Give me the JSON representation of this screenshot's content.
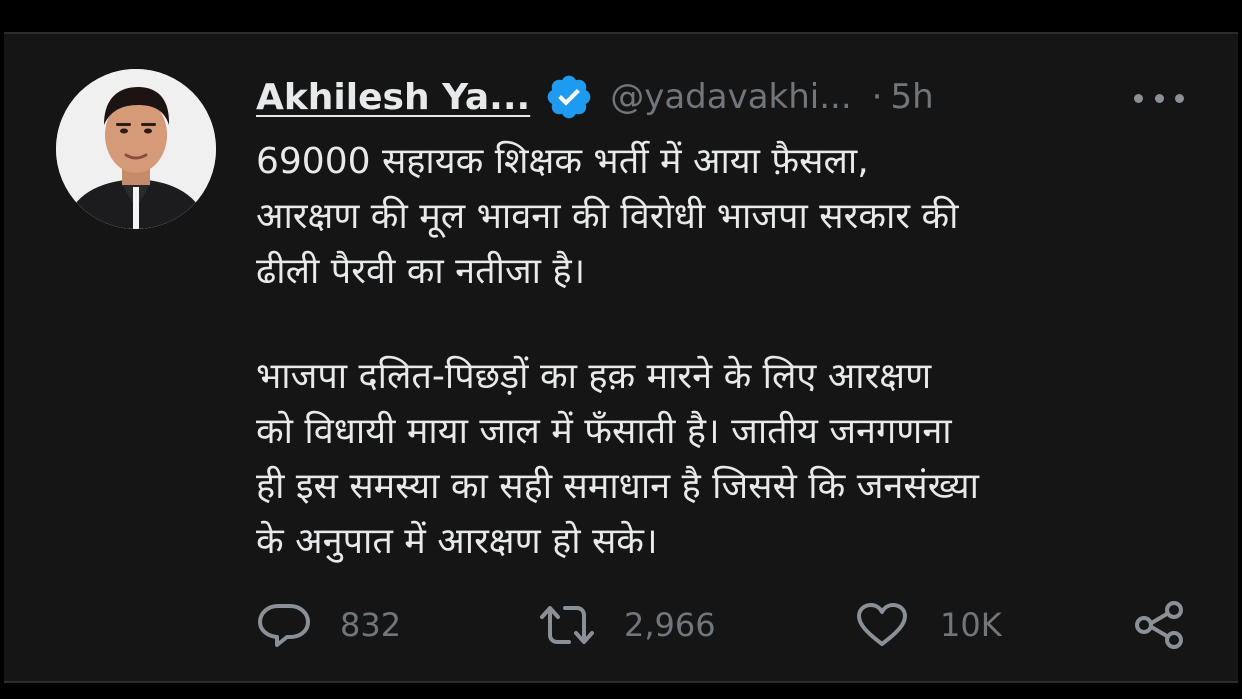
{
  "tweet": {
    "author_name": "Akhilesh Ya...",
    "handle": "@yadavakhi...",
    "separator": "·",
    "time": "5h",
    "text": {
      "para1": [
        "69000 सहायक शिक्षक भर्ती में आया फ़ैसला,",
        "आरक्षण की मूल भावना की विरोधी भाजपा सरकार की",
        "ढीली पैरवी का नतीजा है।"
      ],
      "para2": [
        "भाजपा दलित-पिछड़ों का हक़ मारने के लिए आरक्षण",
        "को विधायी माया जाल में फँसाती है। जातीय जनगणना",
        "ही इस समस्या का सही समाधान है जिससे कि जनसंख्या",
        "के अनुपात में आरक्षण हो सके।"
      ]
    },
    "actions": {
      "replies": "832",
      "retweets": "2,966",
      "likes": "10K"
    },
    "icons": {
      "verified": "verified-badge-icon",
      "more": "more-options-icon",
      "reply": "reply-icon",
      "retweet": "retweet-icon",
      "like": "heart-icon",
      "share": "share-icon"
    },
    "colors": {
      "background": "#151515",
      "text": "#e7e9ea",
      "muted": "#71767b",
      "verified": "#1d9bf0"
    }
  }
}
